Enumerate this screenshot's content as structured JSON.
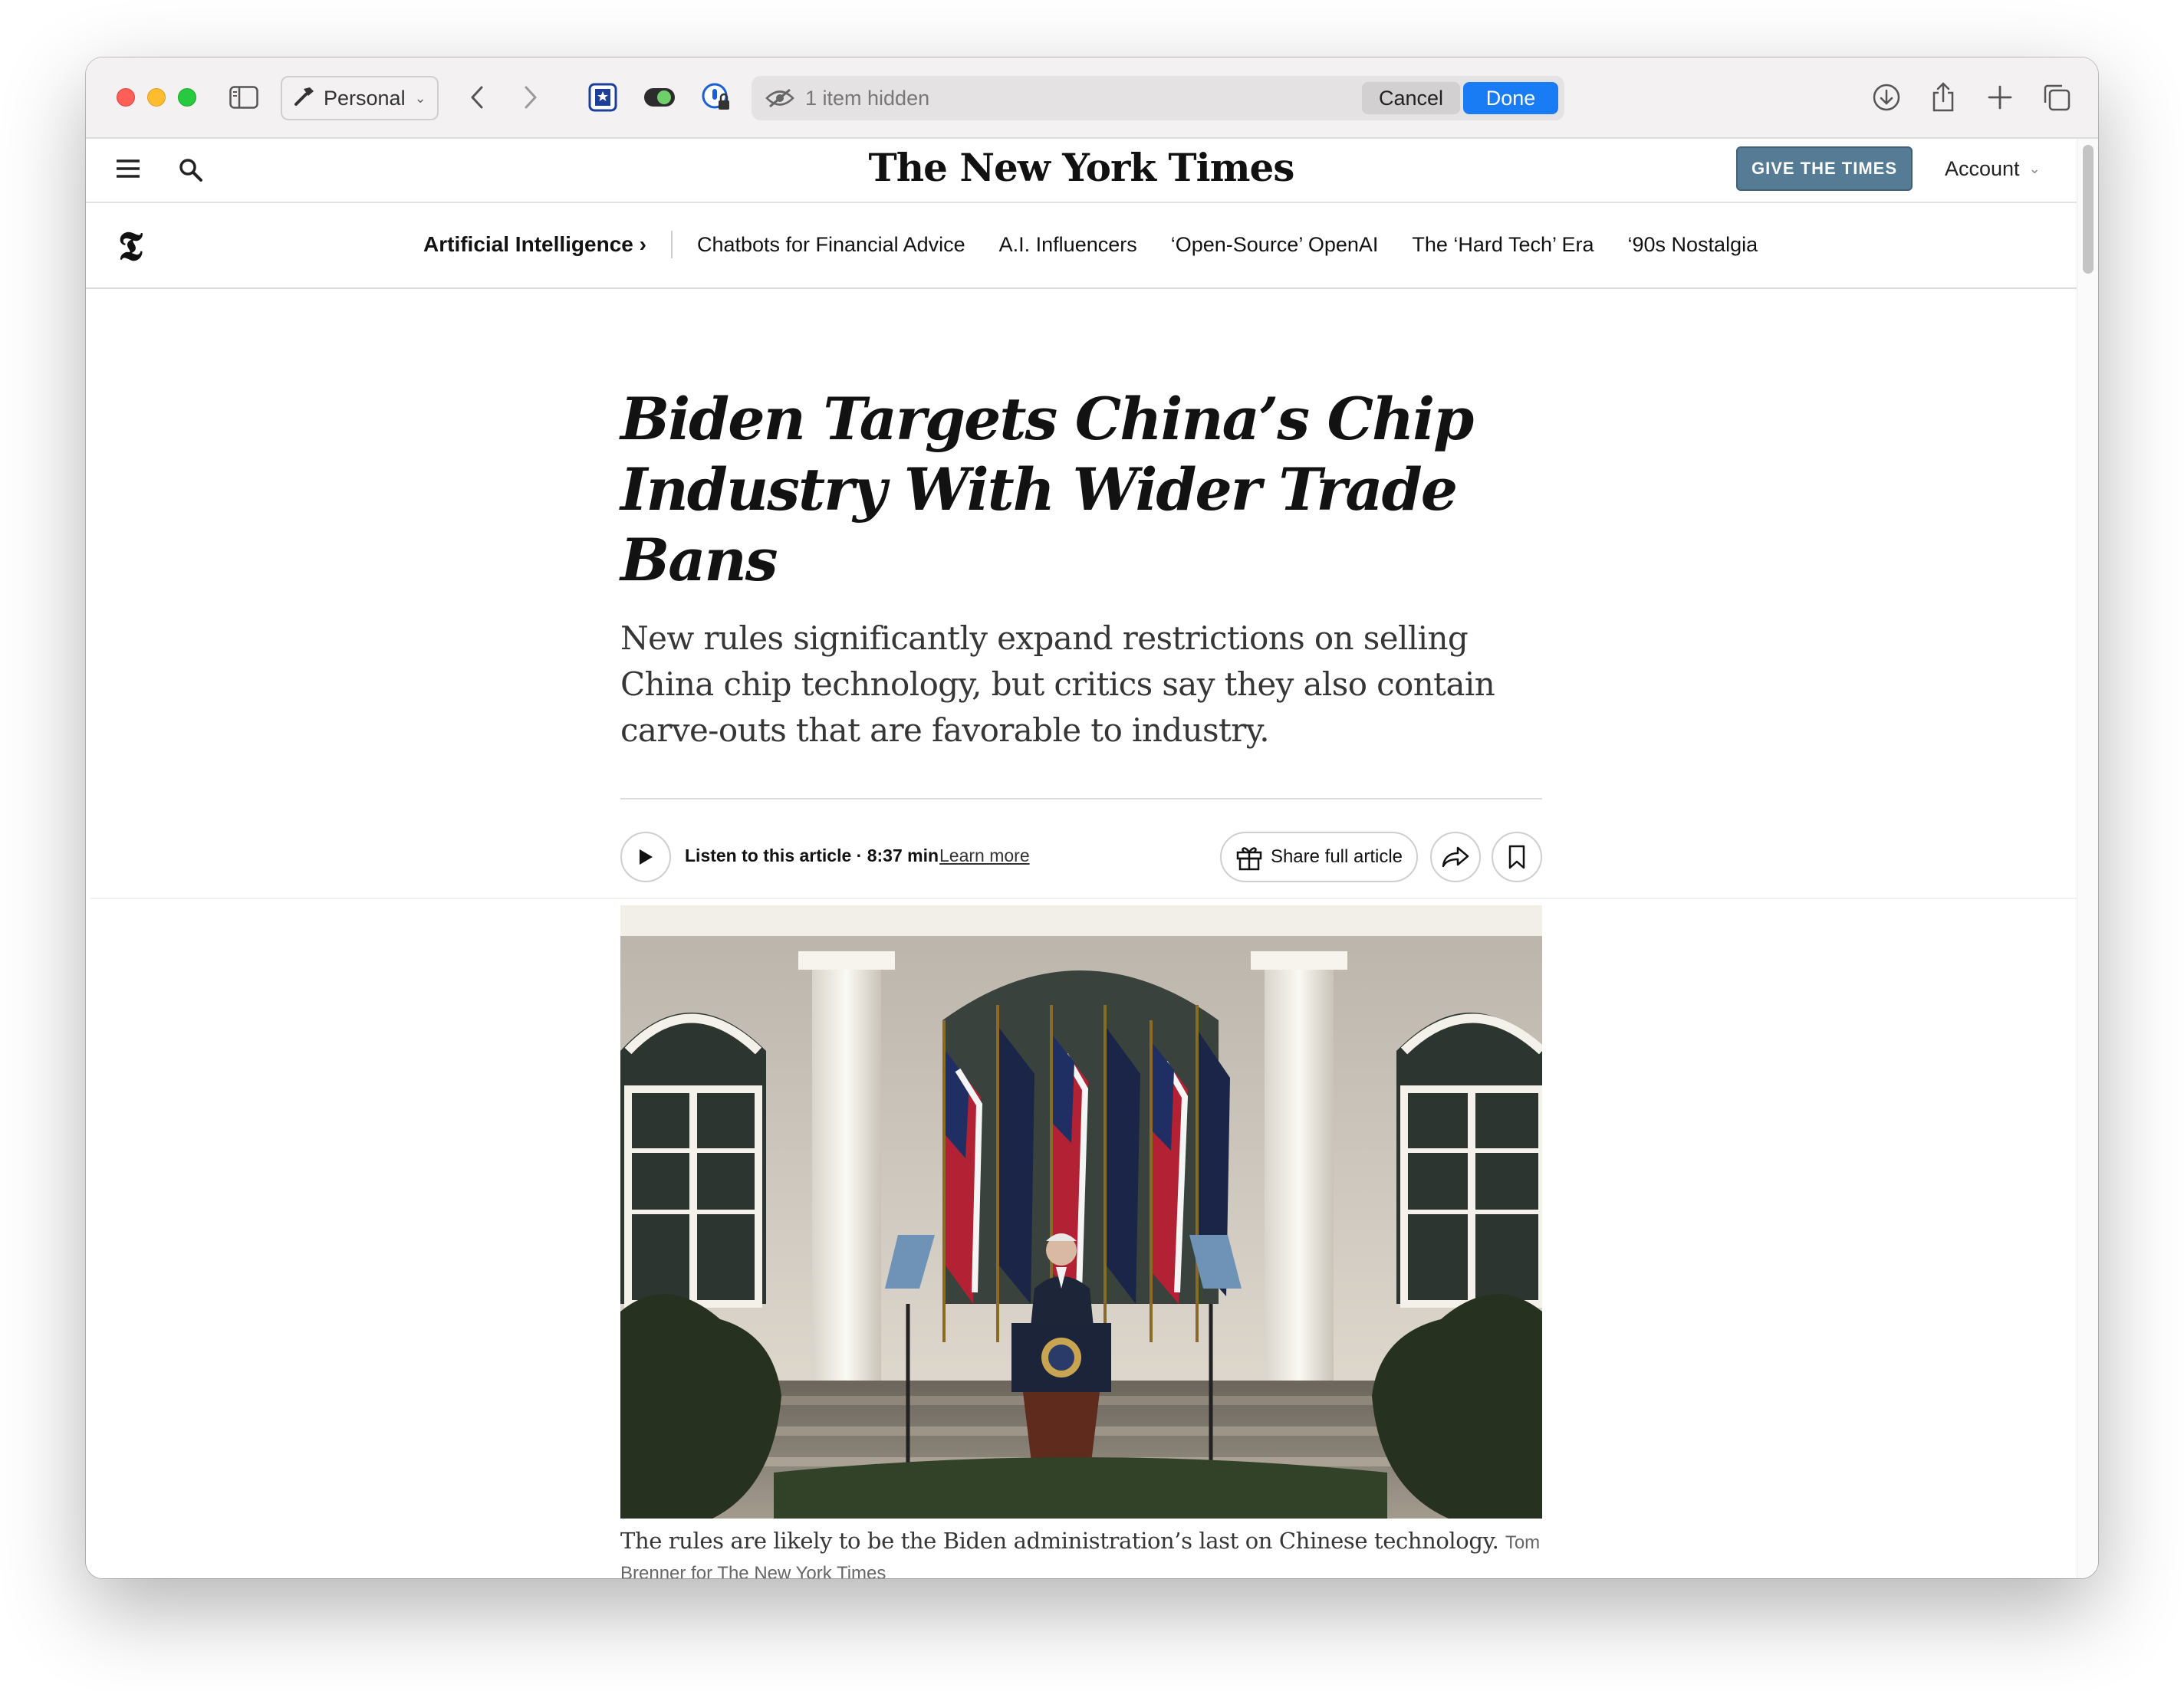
{
  "browser": {
    "profile_label": "Personal",
    "address_status": "1 item hidden",
    "cancel_label": "Cancel",
    "done_label": "Done",
    "accent_color": "#1a7cf5"
  },
  "site": {
    "masthead": "The New York Times",
    "give_button": "GIVE THE TIMES",
    "account_label": "Account",
    "brand_color": "#567b95"
  },
  "topic_nav": {
    "section": "Artificial Intelligence ›",
    "links": [
      "Chatbots for Financial Advice",
      "A.I. Influencers",
      "‘Open-Source’ OpenAI",
      "The ‘Hard Tech’ Era",
      "‘90s Nostalgia"
    ]
  },
  "article": {
    "headline": "Biden Targets China’s Chip Industry With Wider Trade Bans",
    "summary": "New rules significantly expand restrictions on selling China chip technology, but critics say they also contain carve-outs that are favorable to industry.",
    "listen_label": "Listen to this article · 8:37 min",
    "learn_more": "Learn more",
    "share_full_label": "Share full article",
    "photo": {
      "caption": "The rules are likely to be the Biden administration’s last on Chinese technology.",
      "credit": "Tom Brenner for The New York Times"
    }
  },
  "icons": {
    "toolbar": [
      "sidebar-icon",
      "hammer-icon",
      "back-icon",
      "forward-icon",
      "bookmark-star-icon",
      "toggle-icon",
      "password-icon",
      "download-icon",
      "share-icon",
      "new-tab-icon",
      "tabs-overview-icon"
    ],
    "page": [
      "menu-icon",
      "search-icon",
      "t-logo-icon",
      "play-icon",
      "gift-icon",
      "share-arrow-icon",
      "bookmark-icon"
    ]
  }
}
